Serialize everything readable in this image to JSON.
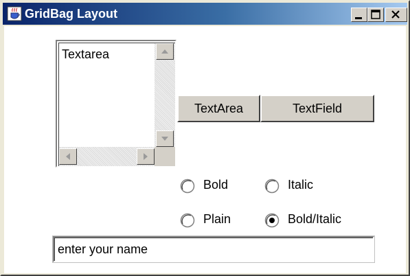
{
  "window": {
    "title": "GridBag Layout",
    "titlebar_colors": [
      "#0a246a",
      "#a6caf0"
    ],
    "buttons": [
      "minimize",
      "maximize",
      "close"
    ]
  },
  "textarea": {
    "content": "Textarea"
  },
  "buttons": {
    "textarea_label": "TextArea",
    "textfield_label": "TextField"
  },
  "radios": [
    {
      "label": "Bold",
      "selected": false
    },
    {
      "label": "Italic",
      "selected": false
    },
    {
      "label": "Plain",
      "selected": false
    },
    {
      "label": "Bold/Italic",
      "selected": true
    }
  ],
  "name_field": {
    "value": "enter your name"
  }
}
